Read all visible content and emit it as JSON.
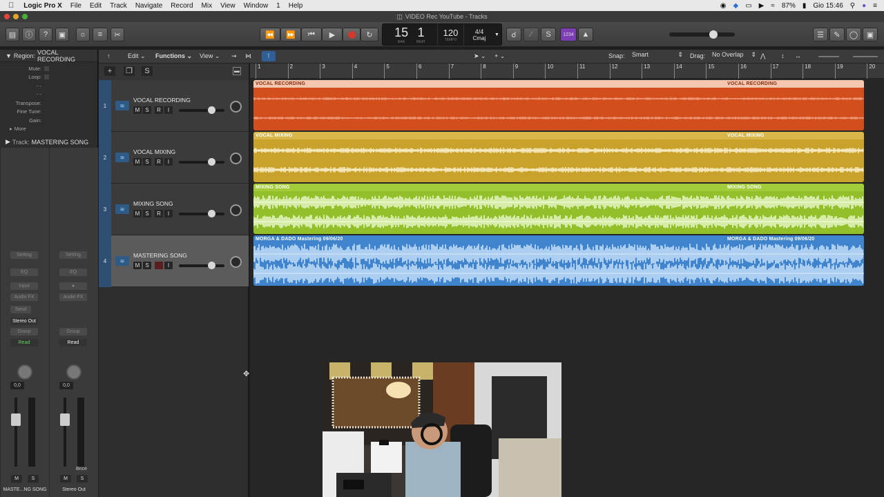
{
  "menubar": {
    "apple": "",
    "app_name": "Logic Pro X",
    "items": [
      "File",
      "Edit",
      "Track",
      "Navigate",
      "Record",
      "Mix",
      "View",
      "Window",
      "1",
      "Help"
    ],
    "battery": "87%",
    "clock": "Gio 15:46"
  },
  "window": {
    "title": "VIDEO Rec YouTube - Tracks"
  },
  "lcd": {
    "bar": "15",
    "beat": "1",
    "bar_label": "BAR",
    "beat_label": "BEAT",
    "tempo": "120",
    "tempo_label": "TEMPO",
    "signature": "4/4",
    "key": "Cmaj"
  },
  "control": {
    "count_in": "1234"
  },
  "inspector": {
    "region_label": "Region:",
    "region_name": "VOCAL RECORDING",
    "mute": "Mute:",
    "loop": "Loop:",
    "transpose": "Transpose:",
    "fine_tune": "Fine Tune:",
    "gain": "Gain:",
    "more": "More",
    "track_label": "Track:",
    "track_name": "MASTERING SONG",
    "strip1": {
      "setting": "Setting",
      "eq": "EQ",
      "input": "Input",
      "audio_fx": "Audio FX",
      "send": "Send",
      "output": "Stereo Out",
      "group": "Group",
      "automation": "Read",
      "value": "0,0",
      "mute": "M",
      "solo": "S",
      "name": "MASTE...NG SONG"
    },
    "strip2": {
      "setting": "Setting",
      "eq": "EQ",
      "audio_fx": "Audio FX",
      "group": "Group",
      "automation": "Read",
      "value": "0,0",
      "bounce": "Bnce",
      "mute": "M",
      "solo": "S",
      "name": "Stereo Out"
    }
  },
  "toolbar": {
    "edit": "Edit",
    "functions": "Functions",
    "view": "View",
    "snap_label": "Snap:",
    "snap_value": "Smart",
    "drag_label": "Drag:",
    "drag_value": "No Overlap",
    "s_button": "S"
  },
  "ruler": [
    "1",
    "2",
    "3",
    "4",
    "5",
    "6",
    "7",
    "8",
    "9",
    "10",
    "11",
    "12",
    "13",
    "14",
    "15",
    "16",
    "17",
    "18",
    "19",
    "20"
  ],
  "tracks": [
    {
      "num": "1",
      "name": "VOCAL RECORDING",
      "m": "M",
      "s": "S",
      "r": "R",
      "i": "I",
      "region": "VOCAL RECORDING",
      "region_end": "VOCAL RECORDING",
      "color": "#d24e1c",
      "band": "#f5c7b0",
      "wave": "#f1a083"
    },
    {
      "num": "2",
      "name": "VOCAL MIXING",
      "m": "M",
      "s": "S",
      "r": "R",
      "i": "I",
      "region": "VOCAL MIXING",
      "region_end": "VOCAL MIXING",
      "color": "#c9a22c",
      "band": "#d9b64a",
      "wave": "#fff6d8"
    },
    {
      "num": "3",
      "name": "MIXING SONG",
      "m": "M",
      "s": "S",
      "r": "R",
      "i": "I",
      "region": "MIXING SONG",
      "region_end": "MIXING SONG",
      "color": "#93c02a",
      "band": "#a3cc3a",
      "wave": "#f4ffe0"
    },
    {
      "num": "4",
      "name": "MASTERING SONG",
      "m": "M",
      "s": "S",
      "r": "",
      "i": "I",
      "region": "MORGA & DADO Mastering 09/06/20",
      "region_end": "MORGA & DADO Mastering 09/06/20",
      "color": "#3f84cc",
      "band": "#3f84cc",
      "wave": "#dbeeff"
    }
  ],
  "colors": {
    "accent_blue": "#2f4e73",
    "record_red": "#d03a2e",
    "count_in_purple": "#7b3fb3"
  }
}
